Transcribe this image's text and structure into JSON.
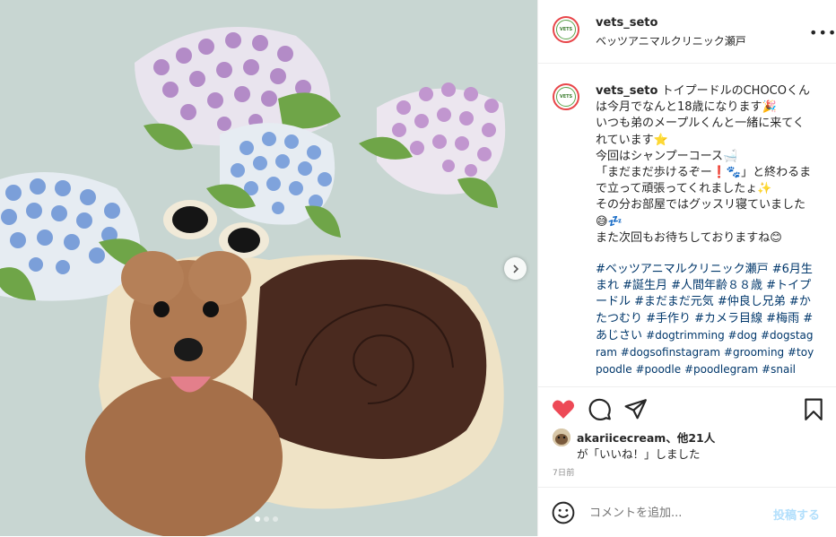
{
  "post": {
    "username": "vets_seto",
    "location": "ベッツアニマルクリニック瀬戸",
    "logo_text": "VETS",
    "caption_text": "トイプードルのCHOCOくんは今月でなんと18歳になります🎉\nいつも弟のメープルくんと一緒に来てくれています⭐\n今回はシャンプーコース🛁\n「まだまだ歩けるぞー❗🐾」と終わるまで立って頑張ってくれましたょ✨\nその分お部屋ではグッスリ寝ていました😅💤\nまた次回もお待ちしておりますね😊",
    "hashtags": "#ベッツアニマルクリニック瀬戸 #6月生まれ #誕生月 #人間年齢８８歳 #トイプードル #まだまだ元気 #仲良し兄弟 #かたつむり #手作り #カメラ目線 #梅雨 #あじさい",
    "hashtags_small": "#dogtrimming #dog #dogstagram #dogsofinstagram #grooming #toypoodle #poodle #poodlegram #snail"
  },
  "likes": {
    "user": "akariicecream",
    "others": "、他21人",
    "suffix": "が「いいね！」しました"
  },
  "time_ago": "7日前",
  "comment": {
    "placeholder": "コメントを追加...",
    "post_label": "投稿する"
  },
  "icons": {
    "like": "heart-icon",
    "comment": "comment-icon",
    "share": "paper-plane-icon",
    "save": "bookmark-icon",
    "emoji": "smiley-icon",
    "more": "more-horizontal-icon",
    "next": "chevron-right-icon"
  },
  "colors": {
    "like_active": "#ed4956",
    "hashtag": "#00376b",
    "post_button": "#b2dffc",
    "muted": "#8e8e8e"
  },
  "carousel": {
    "count": 3,
    "active": 0
  }
}
